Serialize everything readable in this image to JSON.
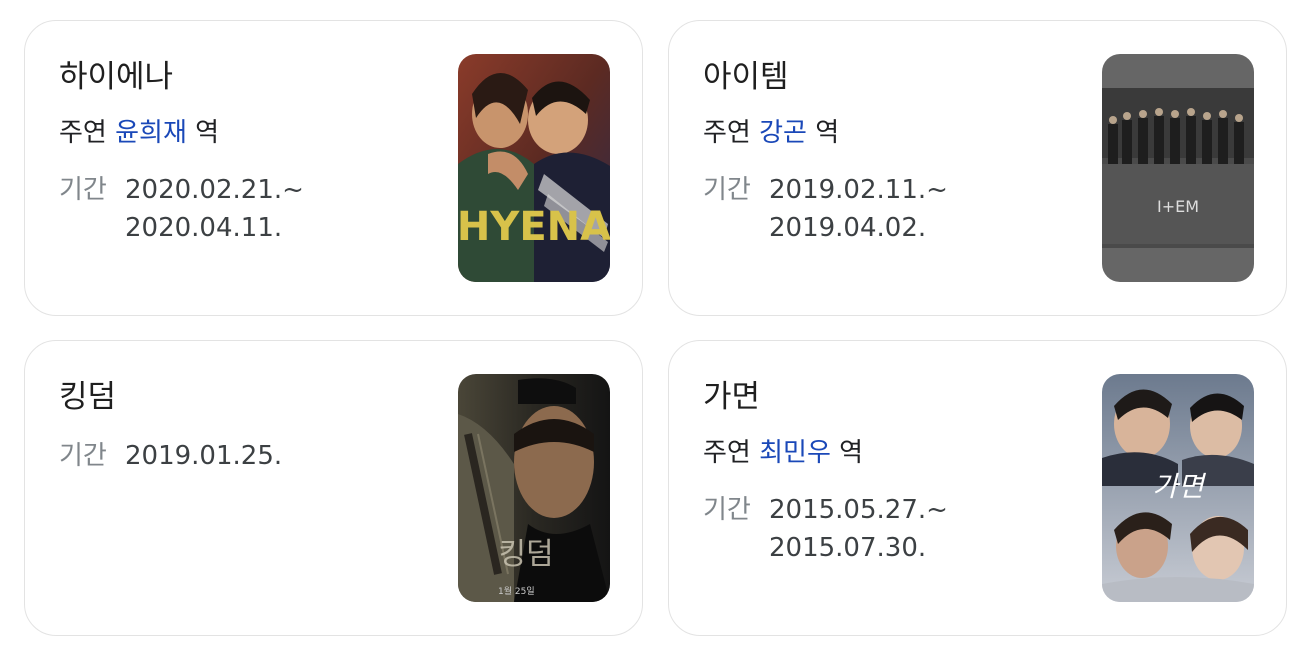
{
  "cards": [
    {
      "title": "하이에나",
      "starring_prefix": "주연",
      "role_name": "윤희재",
      "role_suffix": "역",
      "period_label": "기간",
      "period_start": "2020.02.21.~",
      "period_end": "2020.04.11.",
      "poster_text": "HYENA"
    },
    {
      "title": "아이템",
      "starring_prefix": "주연",
      "role_name": "강곤",
      "role_suffix": "역",
      "period_label": "기간",
      "period_start": "2019.02.11.~",
      "period_end": "2019.04.02.",
      "poster_text": "I+EM"
    },
    {
      "title": "킹덤",
      "period_label": "기간",
      "period_start": "2019.01.25.",
      "poster_text": "킹덤",
      "poster_date": "1월 25일"
    },
    {
      "title": "가면",
      "starring_prefix": "주연",
      "role_name": "최민우",
      "role_suffix": "역",
      "period_label": "기간",
      "period_start": "2015.05.27.~",
      "period_end": "2015.07.30.",
      "poster_text": "가면"
    }
  ],
  "colors": {
    "link": "#1a48b8",
    "label": "#80868b",
    "value": "#3c4043",
    "border": "#e3e3e3"
  },
  "icons": {
    "poster_0": "hyena-poster-image",
    "poster_1": "item-poster-image",
    "poster_2": "kingdom-poster-image",
    "poster_3": "mask-poster-image"
  }
}
